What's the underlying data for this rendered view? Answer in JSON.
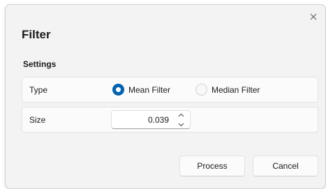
{
  "dialog": {
    "title": "Filter",
    "close_icon": "close-icon"
  },
  "settings": {
    "section_label": "Settings",
    "type": {
      "label": "Type",
      "options": [
        {
          "label": "Mean Filter",
          "selected": true
        },
        {
          "label": "Median Filter",
          "selected": false
        }
      ]
    },
    "size": {
      "label": "Size",
      "value": "0.039"
    }
  },
  "buttons": {
    "process": "Process",
    "cancel": "Cancel"
  },
  "colors": {
    "accent": "#0063b1",
    "dialog_bg": "#f3f3f3",
    "row_bg": "#fbfbfb"
  }
}
